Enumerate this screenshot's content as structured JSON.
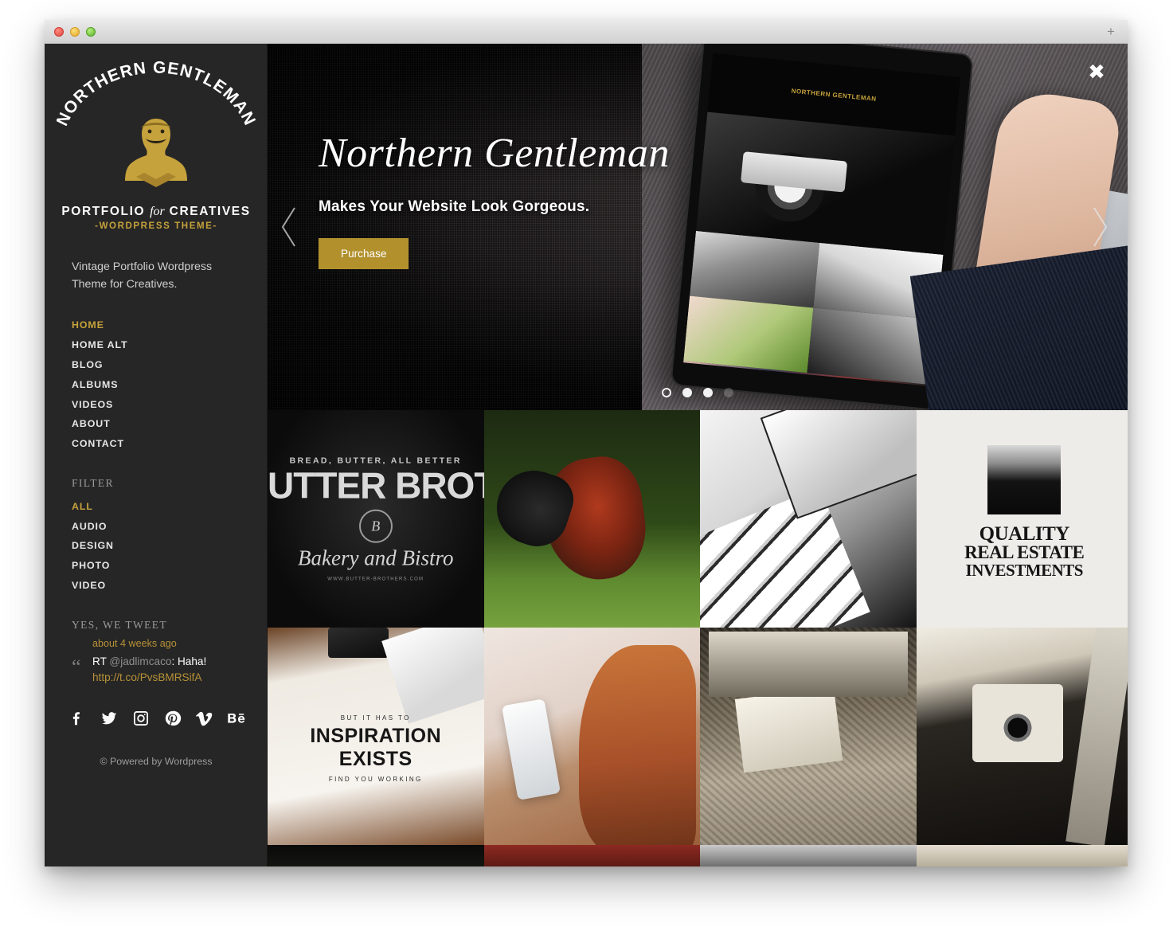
{
  "window": {
    "traffic_lights": [
      "close",
      "minimize",
      "zoom"
    ],
    "newtab_label": "+"
  },
  "sidebar": {
    "logo": {
      "arc_text": "NORTHERN GENTLEMAN",
      "line1_a": "PORTFOLIO",
      "line1_script": "for",
      "line1_b": "CREATIVES",
      "line2": "-WORDPRESS THEME-"
    },
    "tagline": "Vintage Portfolio Wordpress Theme for Creatives.",
    "nav": [
      {
        "label": "HOME",
        "active": true
      },
      {
        "label": "HOME ALT",
        "active": false
      },
      {
        "label": "BLOG",
        "active": false
      },
      {
        "label": "ALBUMS",
        "active": false
      },
      {
        "label": "VIDEOS",
        "active": false
      },
      {
        "label": "ABOUT",
        "active": false
      },
      {
        "label": "CONTACT",
        "active": false
      }
    ],
    "filter_heading": "FILTER",
    "filters": [
      {
        "label": "ALL",
        "active": true
      },
      {
        "label": "AUDIO",
        "active": false
      },
      {
        "label": "DESIGN",
        "active": false
      },
      {
        "label": "PHOTO",
        "active": false
      },
      {
        "label": "VIDEO",
        "active": false
      }
    ],
    "tweet_heading": "YES, WE TWEET",
    "tweet": {
      "quote_glyph": "“",
      "time": "about 4 weeks ago",
      "prefix": "RT ",
      "handle": "@jadlimcaco",
      "body": ": Haha!",
      "link": "http://t.co/PvsBMRSifA"
    },
    "social": [
      {
        "name": "facebook-icon",
        "label": "Facebook"
      },
      {
        "name": "twitter-icon",
        "label": "Twitter"
      },
      {
        "name": "instagram-icon",
        "label": "Instagram"
      },
      {
        "name": "pinterest-icon",
        "label": "Pinterest"
      },
      {
        "name": "vimeo-icon",
        "label": "Vimeo"
      },
      {
        "name": "behance-icon",
        "label": "Behance"
      }
    ],
    "footer": "© Powered by Wordpress"
  },
  "hero": {
    "title": "Northern Gentleman",
    "subtitle": "Makes Your Website Look Gorgeous.",
    "cta": "Purchase",
    "close_glyph": "✖",
    "prev_label": "Previous slide",
    "next_label": "Next slide",
    "dots": [
      {
        "state": "active"
      },
      {
        "state": "filled"
      },
      {
        "state": "filled"
      },
      {
        "state": "faint"
      }
    ],
    "tablet_logo": "NORTHERN GENTLEMAN"
  },
  "gallery": {
    "tiles": [
      {
        "name": "tile-bakery",
        "kind": "bakery-logo",
        "top": "BREAD, BUTTER, ALL BETTER",
        "main": "UTTER BROTHER",
        "badge": "B",
        "script": "Bakery and Bistro",
        "url": "WWW.BUTTER-BROTHERS.COM"
      },
      {
        "name": "tile-rooster",
        "kind": "photo",
        "alt": "Rooster in grass"
      },
      {
        "name": "tile-keyboard",
        "kind": "photo",
        "alt": "Keyboard and floppy disks"
      },
      {
        "name": "tile-real-estate",
        "kind": "lettering",
        "l1": "QUALITY",
        "l2": "REAL ESTATE",
        "l3": "INVESTMENTS"
      },
      {
        "name": "tile-inspiration",
        "kind": "lettering",
        "top": "BUT IT HAS TO",
        "m1": "INSPIRATION",
        "m2": "EXISTS",
        "bottom": "FIND YOU WORKING"
      },
      {
        "name": "tile-phone",
        "kind": "photo",
        "alt": "Woman using phone"
      },
      {
        "name": "tile-street",
        "kind": "photo",
        "alt": "Men reading newspapers on street"
      },
      {
        "name": "tile-camera",
        "kind": "photo",
        "alt": "Photographer holding vintage camera"
      }
    ],
    "partial_row": [
      {
        "name": "tile-partial-1"
      },
      {
        "name": "tile-partial-2"
      },
      {
        "name": "tile-partial-3"
      },
      {
        "name": "tile-partial-4"
      }
    ]
  }
}
